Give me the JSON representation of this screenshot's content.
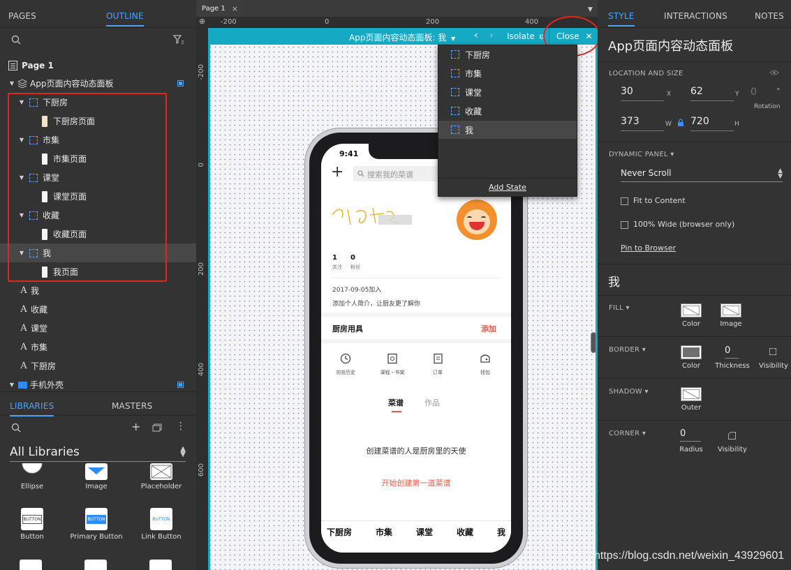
{
  "left": {
    "tabs": {
      "pages": "PAGES",
      "outline": "OUTLINE"
    },
    "tree": {
      "page": "Page 1",
      "panel": "App页面内容动态面板",
      "states": [
        {
          "state": "下厨房",
          "child": "下厨房页面"
        },
        {
          "state": "市集",
          "child": "市集页面"
        },
        {
          "state": "课堂",
          "child": "课堂页面"
        },
        {
          "state": "收藏",
          "child": "收藏页面"
        },
        {
          "state": "我",
          "child": "我页面"
        }
      ],
      "texts": [
        "我",
        "收藏",
        "课堂",
        "市集",
        "下厨房"
      ],
      "shell": "手机外壳"
    },
    "libs": {
      "tabs": {
        "libraries": "LIBRARIES",
        "masters": "MASTERS"
      },
      "selector": "All Libraries",
      "items": [
        "Ellipse",
        "Image",
        "Placeholder",
        "Button",
        "Primary Button",
        "Link Button"
      ],
      "button_text": "BUTTON"
    }
  },
  "canvas": {
    "page_tab": "Page 1",
    "ruler_top": [
      "-200",
      "0",
      "200",
      "400"
    ],
    "ruler_left": [
      "-200",
      "0",
      "200",
      "400",
      "600"
    ],
    "bar": {
      "title": "App页面内容动态面板: 我",
      "isolate": "Isolate",
      "close": "Close"
    },
    "dropdown": {
      "states": [
        "下厨房",
        "市集",
        "课堂",
        "收藏",
        "我"
      ],
      "selected_index": 4,
      "add_state": "Add State"
    },
    "phone": {
      "time": "9:41",
      "search_placeholder": "搜索我的菜谱",
      "follow_count": "1",
      "follow_label": "关注",
      "fans_count": "0",
      "fans_label": "粉丝",
      "join_date": "2017-09-05加入",
      "bio": "添加个人简介，让厨友更了解你",
      "kitchen_tools": "厨房用具",
      "add": "添加",
      "actions": [
        "浏览历史",
        "课程・书架",
        "订单",
        "钱包"
      ],
      "content_tabs": [
        "菜谱",
        "作品"
      ],
      "empty_text": "创建菜谱的人是厨房里的天使",
      "cta": "开始创建第一道菜谱",
      "bottom_nav": [
        "下厨房",
        "市集",
        "课堂",
        "收藏",
        "我"
      ]
    },
    "accent": "#15a9c3",
    "highlight": "#e0271f"
  },
  "right": {
    "tabs": {
      "style": "STYLE",
      "interactions": "INTERACTIONS",
      "notes": "NOTES"
    },
    "title": "App页面内容动态面板",
    "location_size": "LOCATION AND SIZE",
    "x": "30",
    "y": "62",
    "rotation": "0",
    "rotation_label": "Rotation",
    "w": "373",
    "h": "720",
    "unit_x": "X",
    "unit_y": "Y",
    "unit_w": "W",
    "unit_h": "H",
    "degree": "°",
    "dynamic_panel": "DYNAMIC PANEL ▾",
    "scroll": "Never Scroll",
    "fit_content": "Fit to Content",
    "wide": "100% Wide (browser only)",
    "pin": "Pin to Browser",
    "state_name": "我",
    "fill": "FILL ▾",
    "color": "Color",
    "image": "Image",
    "border": "BORDER ▾",
    "thickness_val": "0",
    "thickness": "Thickness",
    "visibility": "Visibility",
    "shadow": "SHADOW ▾",
    "outer": "Outer",
    "corner": "CORNER ▾",
    "radius_val": "0",
    "radius": "Radius"
  },
  "watermark": "https://blog.csdn.net/weixin_43929601"
}
